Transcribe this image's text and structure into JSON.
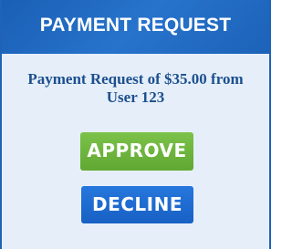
{
  "header": {
    "title": "PAYMENT REQUEST"
  },
  "message": {
    "text": "Payment Request of $35.00 from User 123"
  },
  "actions": {
    "approve_label": "APPROVE",
    "decline_label": "DECLINE"
  },
  "colors": {
    "header_bg": "#1f69c2",
    "panel_bg": "#e6eff9",
    "message_text": "#1c4f8f",
    "approve_bg": "#6ab43a",
    "decline_bg": "#1d6ad0"
  }
}
